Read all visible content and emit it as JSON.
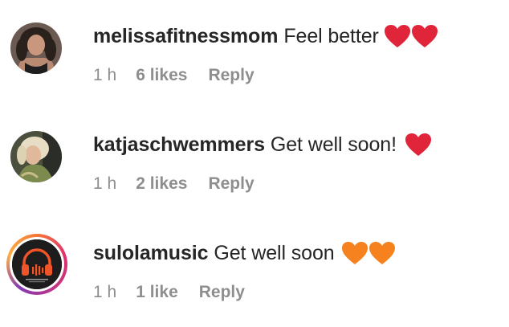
{
  "comments": [
    {
      "username": "melissafitnessmom",
      "text": "Feel better",
      "emoji": [
        "red-heart",
        "red-heart"
      ],
      "time": "1 h",
      "likes": "6 likes",
      "reply": "Reply"
    },
    {
      "username": "katjaschwemmers",
      "text": "Get well soon!",
      "emoji": [
        "red-heart"
      ],
      "time": "1 h",
      "likes": "2 likes",
      "reply": "Reply"
    },
    {
      "username": "sulolamusic",
      "text": "Get well soon",
      "emoji": [
        "orange-heart",
        "orange-heart"
      ],
      "time": "1 h",
      "likes": "1 like",
      "reply": "Reply"
    }
  ],
  "colors": {
    "red_heart": "#e0243a",
    "orange_heart": "#f5821f",
    "meta_text": "#8e8e8e",
    "primary_text": "#262626"
  }
}
